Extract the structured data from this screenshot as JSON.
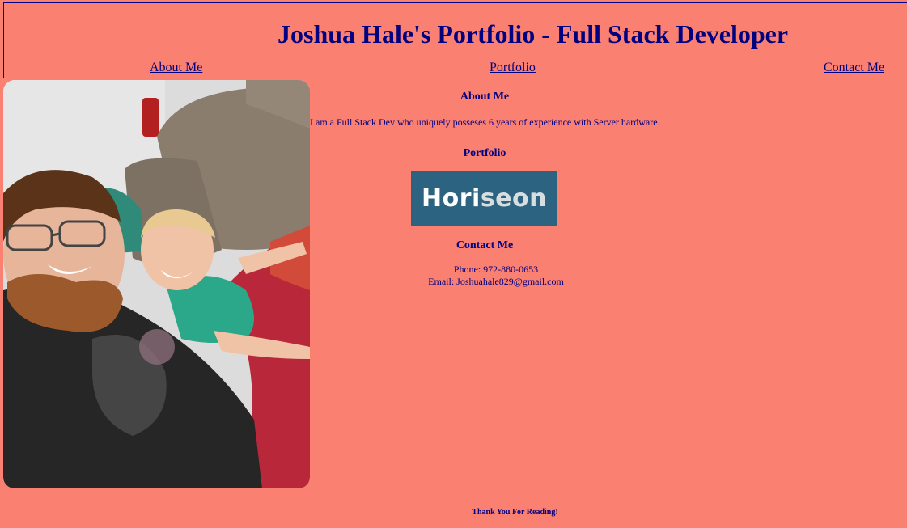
{
  "header": {
    "title": "Joshua Hale's Portfolio - Full Stack Developer"
  },
  "nav": {
    "about": "About Me",
    "portfolio": "Portfolio",
    "contact": "Contact Me"
  },
  "about": {
    "title": "About Me",
    "text": "I am a Full Stack Dev who uniquely posseses 6 years of experience with Server hardware."
  },
  "portfolio": {
    "title": "Portfolio",
    "logo_part1": "Hori",
    "logo_part2": "seon"
  },
  "contact": {
    "title": "Contact Me",
    "phone": "Phone: 972-880-0653",
    "email": "Email: Joshuahale829@gmail.com"
  },
  "footer": {
    "text": "Thank You For Reading!"
  },
  "colors": {
    "background": "#fa8072",
    "text": "#000080",
    "logo_bg": "#2b6380"
  },
  "photo": {
    "icon": "profile-photo"
  }
}
